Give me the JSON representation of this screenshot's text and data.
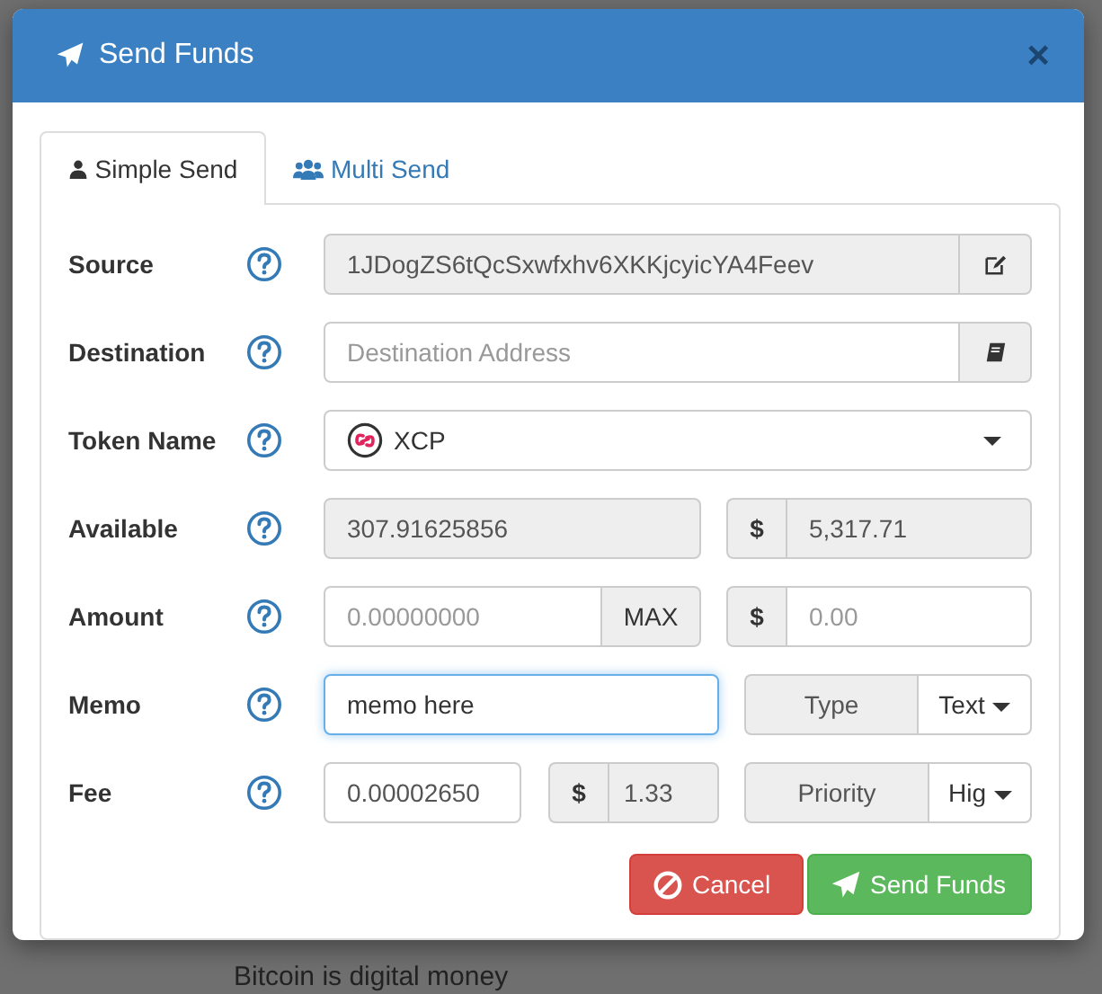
{
  "background": {
    "text": "Bitcoin is digital money"
  },
  "modal": {
    "title": "Send Funds",
    "close": "×",
    "tabs": [
      {
        "label": "Simple Send",
        "selected": true
      },
      {
        "label": "Multi Send",
        "selected": false
      }
    ],
    "rows": [
      {
        "kind": "source",
        "label": "Source",
        "field": {
          "value": "1JDogZS6tQcSxwfxhv6XKKjcyicYA4Feev",
          "readonly": true
        }
      },
      {
        "kind": "destination",
        "label": "Destination",
        "field": {
          "placeholder": "Destination Address",
          "readonly": false
        }
      },
      {
        "kind": "token",
        "label": "Token Name",
        "field": {
          "value": "XCP",
          "readonly": false
        }
      },
      {
        "kind": "balance",
        "label": "Available",
        "field": {
          "value": "307.91625856",
          "readonly": true
        },
        "usd": {
          "symbol": "$",
          "value": "5,317.71",
          "readonly": true
        }
      },
      {
        "kind": "amount",
        "label": "Amount",
        "field": {
          "placeholder": "0.00000000",
          "readonly": false
        },
        "addon": "MAX",
        "usd": {
          "symbol": "$",
          "placeholder": "0.00",
          "readonly": false
        }
      },
      {
        "kind": "memo",
        "label": "Memo",
        "field": {
          "value": "memo here",
          "readonly": false,
          "focused": true
        },
        "option": {
          "label": "Type",
          "value": "Text"
        }
      },
      {
        "kind": "fee",
        "label": "Fee",
        "field": {
          "value": "0.00002650",
          "readonly": false
        },
        "usd": {
          "symbol": "$",
          "value": "1.33",
          "readonly": true
        },
        "option": {
          "label": "Priority",
          "value": "Hig"
        }
      }
    ],
    "buttons": [
      {
        "kind": "cancel",
        "label": "Cancel"
      },
      {
        "kind": "send",
        "label": "Send Funds"
      }
    ]
  }
}
